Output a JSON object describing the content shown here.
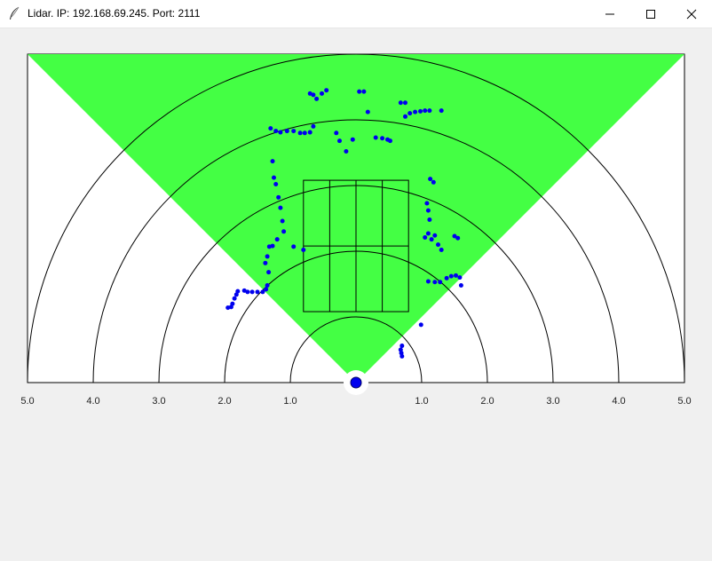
{
  "window": {
    "title": "Lidar. IP: 192.168.69.245. Port: 2111",
    "icon": "feather-icon",
    "controls": [
      "minimize-icon",
      "maximize-icon",
      "close-icon"
    ]
  },
  "colors": {
    "scan_area": "#44ff44",
    "points": "#0000ee",
    "lines": "#000000",
    "plot_background": "#ffffff"
  },
  "axis": {
    "ticks_left": [
      "5.0",
      "4.0",
      "3.0",
      "2.0",
      "1.0"
    ],
    "ticks_right": [
      "1.0",
      "2.0",
      "3.0",
      "4.0",
      "5.0"
    ]
  },
  "chart_data": {
    "type": "scatter",
    "range_rings_m": [
      1,
      2,
      3,
      4,
      5
    ],
    "max_range_m": 5,
    "field_of_view_deg": 270,
    "grid": true,
    "points": [
      [
        -0.7,
        4.4
      ],
      [
        -0.65,
        4.38
      ],
      [
        -0.6,
        4.32
      ],
      [
        -0.52,
        4.4
      ],
      [
        -0.45,
        4.45
      ],
      [
        0.05,
        4.43
      ],
      [
        0.12,
        4.43
      ],
      [
        0.18,
        4.12
      ],
      [
        0.68,
        4.26
      ],
      [
        0.75,
        4.26
      ],
      [
        0.75,
        4.05
      ],
      [
        0.82,
        4.1
      ],
      [
        0.9,
        4.12
      ],
      [
        0.98,
        4.13
      ],
      [
        1.05,
        4.14
      ],
      [
        1.12,
        4.14
      ],
      [
        1.3,
        4.14
      ],
      [
        -1.3,
        3.87
      ],
      [
        -1.22,
        3.83
      ],
      [
        -1.15,
        3.81
      ],
      [
        -1.05,
        3.83
      ],
      [
        -0.95,
        3.83
      ],
      [
        -0.85,
        3.8
      ],
      [
        -0.78,
        3.8
      ],
      [
        -0.7,
        3.81
      ],
      [
        -0.65,
        3.9
      ],
      [
        -0.3,
        3.8
      ],
      [
        -0.25,
        3.68
      ],
      [
        -0.15,
        3.52
      ],
      [
        -0.05,
        3.7
      ],
      [
        0.3,
        3.73
      ],
      [
        0.4,
        3.72
      ],
      [
        0.48,
        3.7
      ],
      [
        0.52,
        3.68
      ],
      [
        -1.27,
        3.37
      ],
      [
        -1.25,
        3.12
      ],
      [
        -1.22,
        3.02
      ],
      [
        -1.18,
        2.82
      ],
      [
        -1.15,
        2.66
      ],
      [
        -1.12,
        2.46
      ],
      [
        -1.1,
        2.3
      ],
      [
        -1.2,
        2.18
      ],
      [
        -1.27,
        2.08
      ],
      [
        -1.32,
        2.07
      ],
      [
        -1.35,
        1.92
      ],
      [
        -1.38,
        1.82
      ],
      [
        -1.33,
        1.68
      ],
      [
        -1.35,
        1.48
      ],
      [
        -1.37,
        1.42
      ],
      [
        -1.42,
        1.38
      ],
      [
        -1.5,
        1.38
      ],
      [
        -1.58,
        1.38
      ],
      [
        -1.65,
        1.38
      ],
      [
        -1.7,
        1.4
      ],
      [
        -1.8,
        1.39
      ],
      [
        -1.82,
        1.34
      ],
      [
        -1.85,
        1.28
      ],
      [
        -1.88,
        1.2
      ],
      [
        -1.9,
        1.15
      ],
      [
        -1.95,
        1.14
      ],
      [
        -0.95,
        2.07
      ],
      [
        -0.8,
        2.02
      ],
      [
        1.13,
        3.1
      ],
      [
        1.18,
        3.05
      ],
      [
        1.08,
        2.73
      ],
      [
        1.1,
        2.62
      ],
      [
        1.12,
        2.48
      ],
      [
        1.1,
        2.27
      ],
      [
        1.05,
        2.21
      ],
      [
        1.15,
        2.18
      ],
      [
        1.2,
        2.24
      ],
      [
        1.25,
        2.1
      ],
      [
        1.3,
        2.02
      ],
      [
        1.5,
        2.23
      ],
      [
        1.55,
        2.2
      ],
      [
        1.1,
        1.54
      ],
      [
        1.2,
        1.53
      ],
      [
        1.28,
        1.53
      ],
      [
        1.38,
        1.59
      ],
      [
        1.45,
        1.62
      ],
      [
        1.52,
        1.63
      ],
      [
        1.58,
        1.6
      ],
      [
        1.6,
        1.48
      ],
      [
        0.99,
        0.88
      ],
      [
        0.7,
        0.56
      ],
      [
        0.68,
        0.5
      ],
      [
        0.69,
        0.45
      ],
      [
        0.7,
        0.4
      ]
    ]
  }
}
